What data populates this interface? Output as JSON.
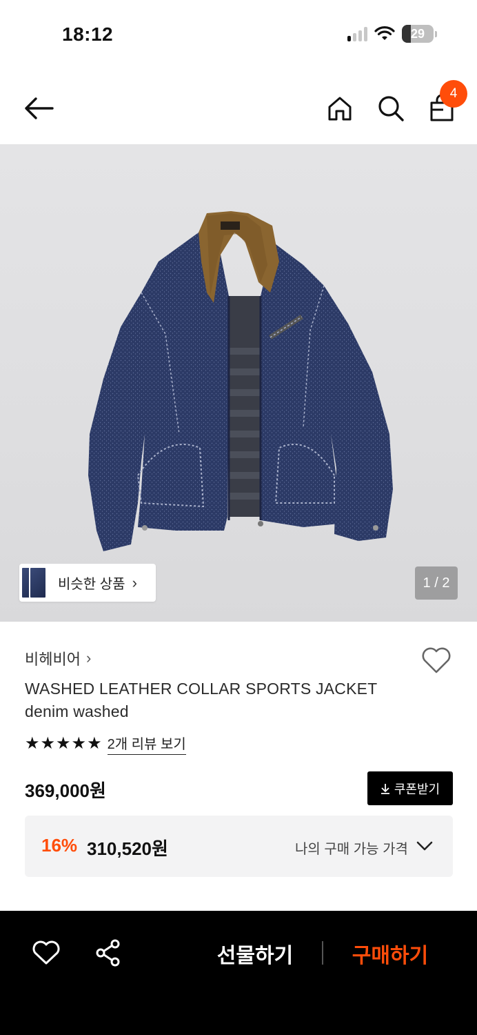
{
  "status_bar": {
    "time": "18:12",
    "battery": "29",
    "battery_fraction": 0.29,
    "icons": [
      "cellular-signal-icon",
      "wifi-icon",
      "battery-icon"
    ]
  },
  "top_nav": {
    "icons": [
      "back-arrow-icon",
      "home-icon",
      "search-icon",
      "shopping-bag-icon"
    ],
    "cart_count": "4"
  },
  "gallery": {
    "similar_label": "비슷한 상품",
    "page_indicator": "1 / 2",
    "image_subject": "navy speckled denim sports jacket with brown suede collar"
  },
  "product": {
    "brand": "비헤비어",
    "title_line1": "WASHED LEATHER COLLAR SPORTS JACKET",
    "title_line2": "denim washed",
    "rating_stars": 5,
    "review_link": "2개 리뷰 보기",
    "price": "369,000원",
    "coupon_label": "쿠폰받기"
  },
  "discount": {
    "percent": "16%",
    "price": "310,520원",
    "label": "나의 구매 가능 가격"
  },
  "bottom_bar": {
    "gift_label": "선물하기",
    "buy_label": "구매하기"
  },
  "colors": {
    "accent": "#ff4d0a",
    "bottom_bar": "#000000",
    "discount_box": "#f3f3f4"
  }
}
